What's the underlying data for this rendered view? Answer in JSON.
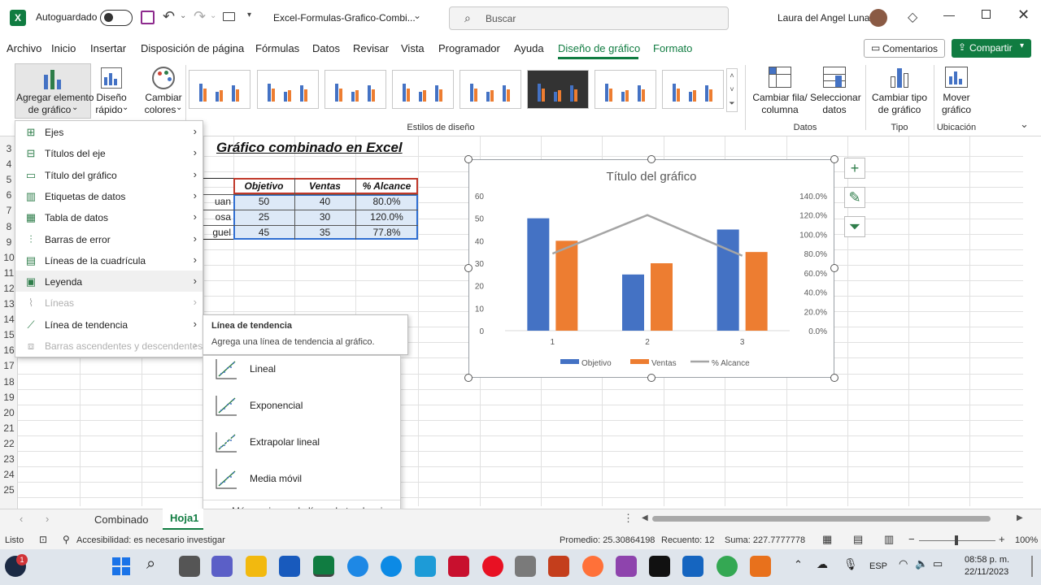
{
  "titlebar": {
    "autosave_label": "Autoguardado",
    "autosave_state": "off",
    "filename": "Excel-Formulas-Grafico-Combi...",
    "search_placeholder": "Buscar",
    "user_name": "Laura del Angel Luna"
  },
  "menu": {
    "items": [
      "Archivo",
      "Inicio",
      "Insertar",
      "Disposición de página",
      "Fórmulas",
      "Datos",
      "Revisar",
      "Vista",
      "Programador",
      "Ayuda",
      "Diseño de gráfico",
      "Formato"
    ],
    "active": "Diseño de gráfico",
    "comments_label": "Comentarios",
    "share_label": "Compartir"
  },
  "ribbon": {
    "add_element_line1": "Agregar elemento",
    "add_element_line2": "de gráfico",
    "quick_layout_line1": "Diseño",
    "quick_layout_line2": "rápido",
    "change_colors_line1": "Cambiar",
    "change_colors_line2": "colores",
    "styles_group_label": "Estilos de diseño",
    "switch_row_col_line1": "Cambiar fila/",
    "switch_row_col_line2": "columna",
    "select_data_line1": "Seleccionar",
    "select_data_line2": "datos",
    "data_group_label": "Datos",
    "change_type_line1": "Cambiar tipo",
    "change_type_line2": "de gráfico",
    "type_group_label": "Tipo",
    "move_chart_line1": "Mover",
    "move_chart_line2": "gráfico",
    "location_group_label": "Ubicación"
  },
  "sheet": {
    "heading": "Gráfico combinado en Excel",
    "row_numbers": [
      "3",
      "4",
      "5",
      "6",
      "7",
      "8",
      "9",
      "10",
      "11",
      "12",
      "13",
      "14",
      "15",
      "16",
      "17",
      "18",
      "19",
      "20",
      "21",
      "22",
      "23",
      "24",
      "25"
    ],
    "table": {
      "headers": [
        "Objetivo",
        "Ventas",
        "% Alcance"
      ],
      "names": [
        "uan",
        "osa",
        "guel"
      ],
      "rows": [
        [
          "50",
          "40",
          "80.0%"
        ],
        [
          "25",
          "30",
          "120.0%"
        ],
        [
          "45",
          "35",
          "77.8%"
        ]
      ]
    }
  },
  "dropdown": {
    "items": [
      {
        "label": "Ejes",
        "icon": "axes-icon",
        "disabled": false
      },
      {
        "label": "Títulos del eje",
        "icon": "axis-titles-icon",
        "disabled": false
      },
      {
        "label": "Título del gráfico",
        "icon": "chart-title-icon",
        "disabled": false
      },
      {
        "label": "Etiquetas de datos",
        "icon": "data-labels-icon",
        "disabled": false
      },
      {
        "label": "Tabla de datos",
        "icon": "data-table-icon",
        "disabled": false
      },
      {
        "label": "Barras de error",
        "icon": "error-bars-icon",
        "disabled": false
      },
      {
        "label": "Líneas de la cuadrícula",
        "icon": "gridlines-icon",
        "disabled": false
      },
      {
        "label": "Leyenda",
        "icon": "legend-icon",
        "disabled": false
      },
      {
        "label": "Líneas",
        "icon": "lines-icon",
        "disabled": true
      },
      {
        "label": "Línea de tendencia",
        "icon": "trendline-icon",
        "disabled": false
      },
      {
        "label": "Barras ascendentes y descendentes",
        "icon": "updown-bars-icon",
        "disabled": true
      }
    ]
  },
  "tooltip": {
    "title": "Línea de tendencia",
    "description": "Agrega una línea de tendencia al gráfico."
  },
  "submenu": {
    "items": [
      "Lineal",
      "Exponencial",
      "Extrapolar lineal",
      "Media móvil"
    ],
    "more_label": "Más opciones de línea de tendencia..."
  },
  "chart_data": {
    "type": "bar",
    "title": "Título del gráfico",
    "categories": [
      "1",
      "2",
      "3"
    ],
    "series": [
      {
        "name": "Objetivo",
        "type": "bar",
        "color": "#4472c4",
        "values": [
          50,
          25,
          45
        ]
      },
      {
        "name": "Ventas",
        "type": "bar",
        "color": "#ed7d31",
        "values": [
          40,
          30,
          35
        ]
      },
      {
        "name": "% Alcance",
        "type": "line",
        "color": "#a5a5a5",
        "axis": "secondary",
        "values": [
          0.8,
          1.2,
          0.778
        ]
      }
    ],
    "y_ticks": [
      "0",
      "10",
      "20",
      "30",
      "40",
      "50",
      "60"
    ],
    "y2_ticks": [
      "0.0%",
      "20.0%",
      "40.0%",
      "60.0%",
      "80.0%",
      "100.0%",
      "120.0%",
      "140.0%"
    ],
    "ylim": [
      0,
      60
    ],
    "y2lim": [
      0,
      1.4
    ],
    "legend_position": "bottom",
    "grid": false
  },
  "sheet_tabs": {
    "tabs": [
      "Combinado",
      "Hoja1"
    ],
    "active": "Hoja1"
  },
  "statusbar": {
    "ready": "Listo",
    "accessibility": "Accesibilidad: es necesario investigar",
    "average": "Promedio: 25.30864198",
    "count": "Recuento: 12",
    "sum": "Suma: 227.7777778",
    "zoom": "100%"
  },
  "taskbar": {
    "language": "ESP",
    "time": "08:58 p. m.",
    "date": "22/11/2023",
    "notification_count": "1"
  },
  "colors": {
    "accent_green": "#107c41",
    "bar_blue": "#4472c4",
    "bar_orange": "#ed7d31",
    "line_gray": "#a5a5a5",
    "table_border_red": "#c0392b",
    "table_border_blue": "#2f6ed1",
    "taskbar_bg": "#dfe5ec"
  }
}
